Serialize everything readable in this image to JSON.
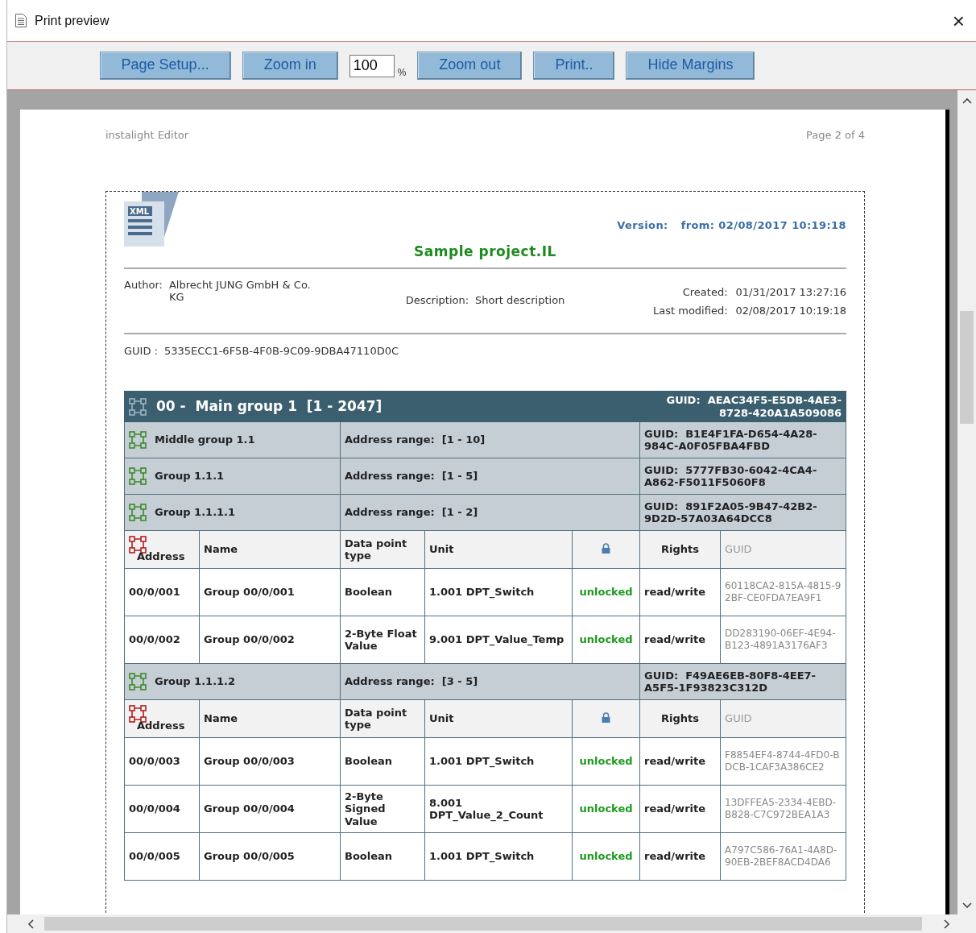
{
  "window": {
    "title": "Print preview",
    "close": "×"
  },
  "toolbar": [
    {
      "kind": "button",
      "label": "Page Setup..."
    },
    {
      "kind": "button",
      "label": "Zoom in"
    },
    {
      "kind": "field",
      "value": "100"
    },
    {
      "kind": "unit",
      "label": "%"
    },
    {
      "kind": "button",
      "label": "Zoom out"
    },
    {
      "kind": "button",
      "label": "Print.."
    },
    {
      "kind": "button",
      "label": "Hide Margins"
    }
  ],
  "page": {
    "header_left": "instalight Editor",
    "header_right": "Page 2 of 4",
    "report": {
      "file_icon_label": "XML",
      "version_label": "Version:",
      "version_value": "from: 02/08/2017 10:19:18",
      "title": "Sample project.IL",
      "author_label": "Author:",
      "author_value": "Albrecht JUNG GmbH & Co. KG",
      "description_label": "Description:",
      "description_value": "Short description",
      "created_label": "Created:",
      "created_value": "01/31/2017 13:27:16",
      "modified_label": "Last modified:",
      "modified_value": "02/08/2017 10:19:18",
      "guid_label": "GUID :",
      "guid_value": "5335ECC1-6F5B-4F0B-9C09-9DBA47110D0C"
    },
    "table": {
      "main_group": {
        "title": "00 -  Main group 1  [1 - 2047]",
        "guid_label": "GUID:",
        "guid": "AEAC34F5-E5DB-4AE3-8728-420A1A509086"
      },
      "rows": [
        {
          "kind": "group",
          "name": "Middle group 1.1",
          "range_label": "Address range:",
          "range": "[1 - 10]",
          "guid_label": "GUID:",
          "guid": "B1E4F1FA-D654-4A28-984C-A0F05FBA4FBD"
        },
        {
          "kind": "group",
          "name": "Group 1.1.1",
          "range_label": "Address range:",
          "range": "[1 - 5]",
          "guid_label": "GUID:",
          "guid": "5777FB30-6042-4CA4-A862-F5011F5060F8"
        },
        {
          "kind": "group",
          "name": "Group 1.1.1.1",
          "range_label": "Address range:",
          "range": "[1 - 2]",
          "guid_label": "GUID:",
          "guid": "891F2A05-9B47-42B2-9D2D-57A03A64DCC8"
        },
        {
          "kind": "header",
          "address": "Address",
          "name": "Name",
          "type": "Data point type",
          "unit": "Unit",
          "rights": "Rights",
          "guid": "GUID"
        },
        {
          "kind": "item",
          "address": "00/0/001",
          "name": "Group 00/0/001",
          "type": "Boolean",
          "unit": "1.001 DPT_Switch",
          "lock": "unlocked",
          "rights": "read/write",
          "guid": "60118CA2-815A-4815-92BF-CE0FDA7EA9F1"
        },
        {
          "kind": "item",
          "address": "00/0/002",
          "name": "Group 00/0/002",
          "type": "2-Byte Float Value",
          "unit": "9.001 DPT_Value_Temp",
          "lock": "unlocked",
          "rights": "read/write",
          "guid": "DD283190-06EF-4E94-B123-4891A3176AF3"
        },
        {
          "kind": "group",
          "name": "Group 1.1.1.2",
          "range_label": "Address range:",
          "range": "[3 - 5]",
          "guid_label": "GUID:",
          "guid": "F49AE6EB-80F8-4EE7-A5F5-1F93823C312D"
        },
        {
          "kind": "header",
          "address": "Address",
          "name": "Name",
          "type": "Data point type",
          "unit": "Unit",
          "rights": "Rights",
          "guid": "GUID"
        },
        {
          "kind": "item",
          "address": "00/0/003",
          "name": "Group 00/0/003",
          "type": "Boolean",
          "unit": "1.001 DPT_Switch",
          "lock": "unlocked",
          "rights": "read/write",
          "guid": "F8854EF4-8744-4FD0-BDCB-1CAF3A386CE2"
        },
        {
          "kind": "item",
          "address": "00/0/004",
          "name": "Group 00/0/004",
          "type": "2-Byte Signed Value",
          "unit": "8.001 DPT_Value_2_Count",
          "lock": "unlocked",
          "rights": "read/write",
          "guid": "13DFFEA5-2334-4EBD-B828-C7C972BEA1A3"
        },
        {
          "kind": "item",
          "address": "00/0/005",
          "name": "Group 00/0/005",
          "type": "Boolean",
          "unit": "1.001 DPT_Switch",
          "lock": "unlocked",
          "rights": "read/write",
          "guid": "A797C586-76A1-4A8D-90EB-2BEF8ACD4DA6"
        }
      ]
    }
  }
}
